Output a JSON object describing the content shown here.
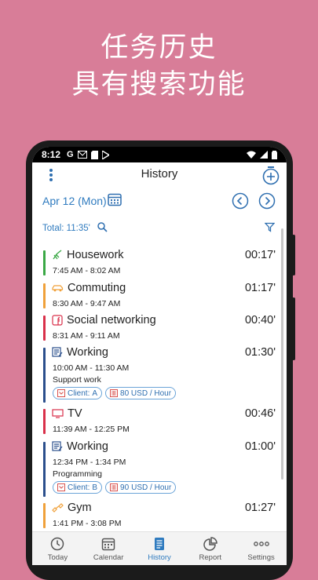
{
  "promo": {
    "line1": "任务历史",
    "line2": "具有搜索功能"
  },
  "status_bar": {
    "time": "8:12",
    "icons": [
      "G"
    ]
  },
  "app_bar": {
    "title": "History"
  },
  "date_bar": {
    "date": "Apr 12 (Mon)"
  },
  "total": {
    "label": "Total: 11:35'"
  },
  "entries": [
    {
      "name": "Housework",
      "duration": "00:17'",
      "range": "7:45 AM - 8:02 AM",
      "color": "#3aa845",
      "icon": "broom-icon"
    },
    {
      "name": "Commuting",
      "duration": "01:17'",
      "range": "8:30 AM - 9:47 AM",
      "color": "#f0a13a",
      "icon": "car-icon"
    },
    {
      "name": "Social networking",
      "duration": "00:40'",
      "range": "8:31 AM - 9:11 AM",
      "color": "#d9304a",
      "icon": "facebook-icon"
    },
    {
      "name": "Working",
      "duration": "01:30'",
      "range": "10:00 AM - 11:30 AM",
      "note": "Support work",
      "color": "#2b4f8c",
      "icon": "work-icon",
      "tags": [
        {
          "label": "Client:",
          "value": "A"
        },
        {
          "label": "",
          "value": "80 USD / Hour"
        }
      ]
    },
    {
      "name": "TV",
      "duration": "00:46'",
      "range": "11:39 AM - 12:25 PM",
      "color": "#d9304a",
      "icon": "tv-icon"
    },
    {
      "name": "Working",
      "duration": "01:00'",
      "range": "12:34 PM - 1:34 PM",
      "note": "Programming",
      "color": "#2b4f8c",
      "icon": "work-icon",
      "tags": [
        {
          "label": "Client:",
          "value": "B"
        },
        {
          "label": "",
          "value": "90",
          "suffix": " USD / Hour"
        }
      ]
    },
    {
      "name": "Gym",
      "duration": "01:27'",
      "range": "1:41 PM - 3:08 PM",
      "color": "#f0a13a",
      "icon": "dumbbell-icon"
    }
  ],
  "bottom_nav": [
    {
      "label": "Today",
      "icon": "clock-icon"
    },
    {
      "label": "Calendar",
      "icon": "calendar-icon"
    },
    {
      "label": "History",
      "icon": "history-icon",
      "active": true
    },
    {
      "label": "Report",
      "icon": "pie-chart-icon"
    },
    {
      "label": "Settings",
      "icon": "more-icon"
    }
  ],
  "colors": {
    "accent": "#2f7bbf",
    "background": "#d87d98"
  }
}
